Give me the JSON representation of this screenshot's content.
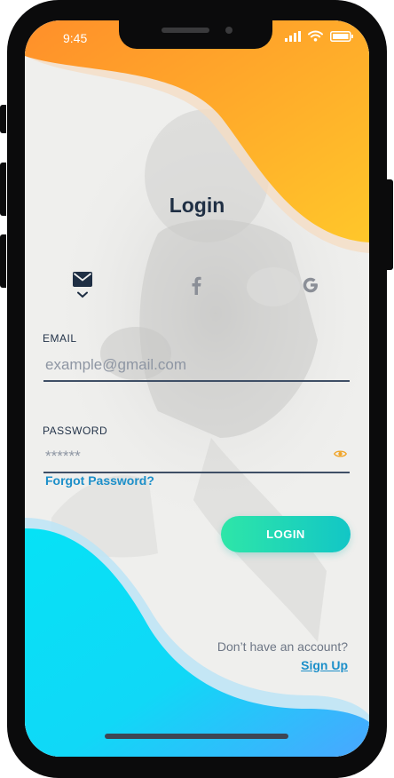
{
  "status_bar": {
    "time": "9:45",
    "icons": [
      "signal-icon",
      "wifi-icon",
      "battery-icon"
    ]
  },
  "title": "Login",
  "login_methods": [
    {
      "icon": "envelope-icon",
      "selected": true
    },
    {
      "icon": "facebook-icon",
      "selected": false
    },
    {
      "icon": "google-icon",
      "selected": false
    }
  ],
  "email": {
    "label": "EMAIL",
    "placeholder": "example@gmail.com",
    "value": ""
  },
  "password": {
    "label": "PASSWORD",
    "placeholder": "******",
    "value": "",
    "toggle_icon": "eye-icon"
  },
  "forgot_password": "Forgot Password?",
  "login_button": "LOGIN",
  "signup": {
    "prompt": "Don’t have an account?",
    "link": "Sign Up"
  },
  "colors": {
    "top_wave_start": "#ff9a2e",
    "top_wave_end": "#ffc72a",
    "bottom_wave_start": "#12d6f5",
    "bottom_wave_end": "#46a8ff",
    "button_start": "#2ee6a8",
    "button_end": "#12c6c6",
    "title": "#1f2f44",
    "link": "#1c8fc9"
  }
}
